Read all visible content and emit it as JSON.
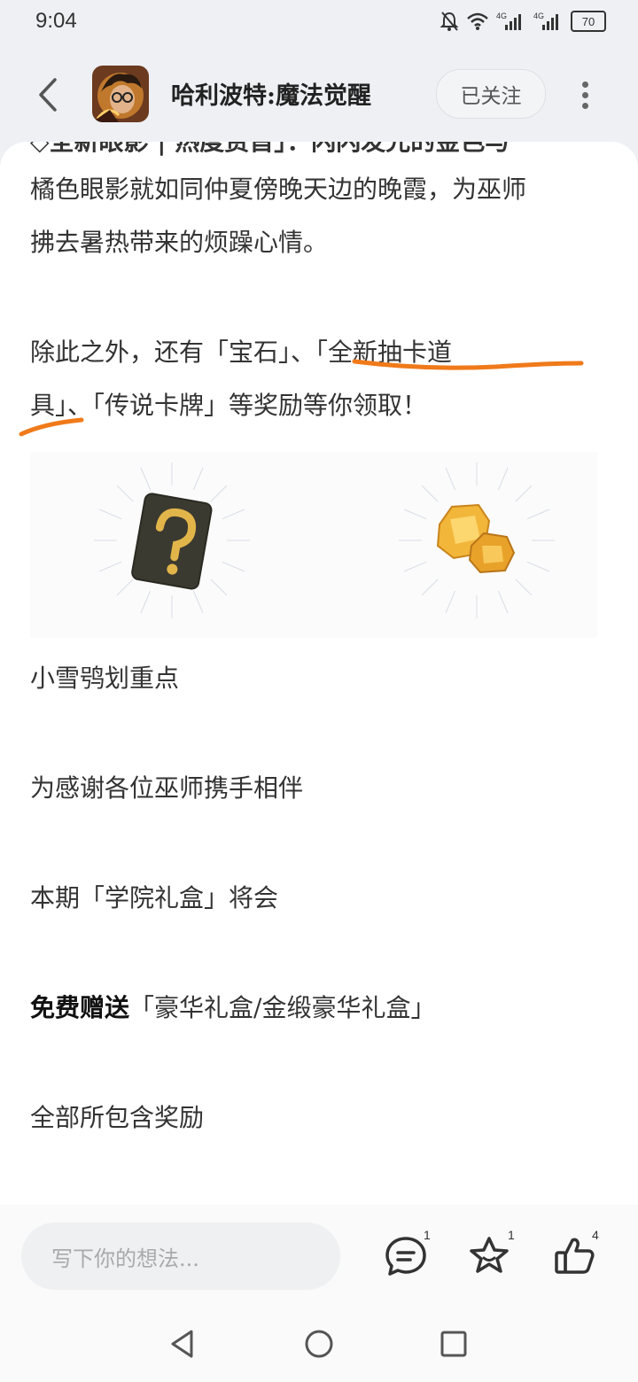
{
  "status": {
    "time": "9:04",
    "battery": "70",
    "signal1": "4G",
    "signal2": "4G"
  },
  "header": {
    "title": "哈利波特:魔法觉醒",
    "follow_label": "已关注"
  },
  "article": {
    "clipped_line": "◇全新眼影 | 热度赏首」：闪闪发光的金色与",
    "para1_line1": "橘色眼影就如同仲夏傍晚天边的晚霞，为巫师",
    "para1_line2": "拂去暑热带来的烦躁心情。",
    "para2_line1_a": "除此之外，还有「宝石」、",
    "para2_line1_b": "「全新抽卡道",
    "para2_line2_a": "具」",
    "para2_line2_b": "、「传说卡牌」等奖励等你领取！",
    "line_key": "小雪鸮划重点",
    "line_thanks": "为感谢各位巫师携手相伴",
    "line_box": "本期「学院礼盒」将会",
    "line_free_bold": "免费赠送",
    "line_free_rest": "「豪华礼盒/金缎豪华礼盒」",
    "line_all": "全部所包含奖励"
  },
  "bottom": {
    "comment_placeholder": "写下你的想法...",
    "comment_count": "1",
    "favorite_count": "1",
    "like_count": "4"
  },
  "colors": {
    "underline": "#f07a1a",
    "gold": "#e8a22a"
  }
}
